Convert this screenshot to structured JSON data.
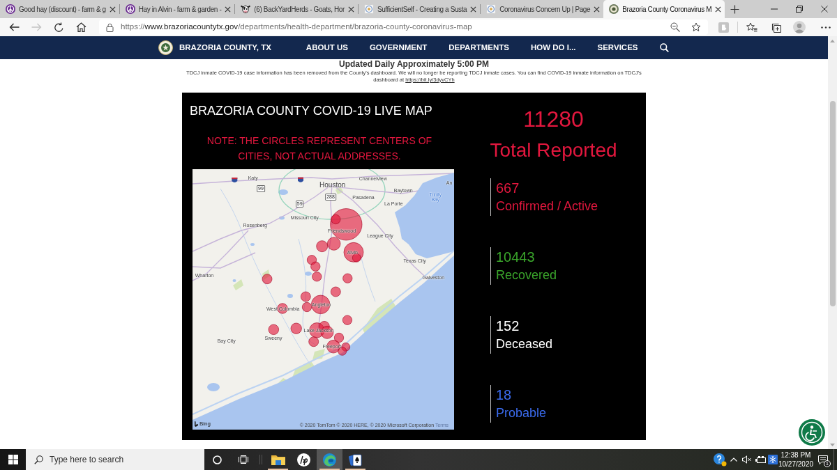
{
  "browser": {
    "tabs": [
      {
        "kind": "peace",
        "title": "Good hay (discount) - farm & g",
        "selected": false
      },
      {
        "kind": "peace",
        "title": "Hay in Alvin - farm & garden -",
        "selected": false
      },
      {
        "kind": "cow",
        "title": "(6) BackYardHerds - Goats, Hor",
        "selected": false
      },
      {
        "kind": "ring",
        "title": "SufficientSelf - Creating a Susta",
        "selected": false
      },
      {
        "kind": "ring",
        "title": "Coronavirus Concern Up | Page",
        "selected": false
      },
      {
        "kind": "seal",
        "title": "Brazoria County Coronavirus M",
        "selected": true
      }
    ],
    "nav_buttons": [
      {
        "kind": "back",
        "disabled": false
      },
      {
        "kind": "forward",
        "disabled": true
      },
      {
        "kind": "refresh",
        "disabled": false
      },
      {
        "kind": "home",
        "disabled": false
      }
    ],
    "address": {
      "scheme": "https://",
      "host": "www.brazoriacountytx.gov",
      "path": "/departments/health-department/brazoria-county-coronavirus-map"
    }
  },
  "site_nav": {
    "title": "BRAZORIA COUNTY, TX",
    "items": [
      "ABOUT US",
      "GOVERNMENT",
      "DEPARTMENTS",
      "HOW DO I...",
      "SERVICES"
    ]
  },
  "page": {
    "updated": "Updated Daily Approximately 5:00 PM",
    "notice": "TDCJ inmate COVID-19 case information has been removed from the County's dashboard. We will no longer be reporting TDCJ inmate cases. You can find COVID-19 inmate information on TDCJ's dashboard at",
    "notice_link": "https://bit.ly/3dyvCYh"
  },
  "dashboard": {
    "title": "BRAZORIA COUNTY COVID-19 LIVE MAP",
    "note": "NOTE: THE CIRCLES REPRESENT CENTERS OF CITIES, NOT ACTUAL ADDRESSES.",
    "map": {
      "labels": [
        {
          "kind": "city",
          "text": "Katy"
        },
        {
          "kind": "major",
          "text": "Houston"
        },
        {
          "kind": "city",
          "text": "Channelview"
        },
        {
          "kind": "city",
          "text": "An"
        },
        {
          "kind": "city",
          "text": "Baytown"
        },
        {
          "kind": "city",
          "text": "Pasadena"
        },
        {
          "kind": "water",
          "text": "Trinity Bay"
        },
        {
          "kind": "city",
          "text": "La Porte"
        },
        {
          "kind": "city",
          "text": "Missouri City"
        },
        {
          "kind": "city",
          "text": "Rosenberg"
        },
        {
          "kind": "city",
          "text": "Friendswood"
        },
        {
          "kind": "city",
          "text": "League City"
        },
        {
          "kind": "city",
          "text": "Alvin"
        },
        {
          "kind": "city",
          "text": "Texas City"
        },
        {
          "kind": "city",
          "text": "Wharton"
        },
        {
          "kind": "city",
          "text": "Galveston"
        },
        {
          "kind": "city",
          "text": "Angleton"
        },
        {
          "kind": "city",
          "text": "West Columbia"
        },
        {
          "kind": "city",
          "text": "Sweeny"
        },
        {
          "kind": "city",
          "text": "Lake Jackson"
        },
        {
          "kind": "city",
          "text": "Bay City"
        },
        {
          "kind": "city",
          "text": "Freeport"
        }
      ],
      "shields": [
        "99",
        "59",
        "288"
      ],
      "logo": "Bing",
      "credit": "© 2020 TomTom © 2020 HERE, © 2020 Microsoft Corporation",
      "terms": "Terms"
    },
    "total": {
      "value": "11280",
      "label": "Total Reported"
    },
    "stats": [
      {
        "value": "667",
        "label": "Confirmed / Active",
        "color": "#e3173e"
      },
      {
        "value": "10443",
        "label": "Recovered",
        "color": "#3aa52b"
      },
      {
        "value": "152",
        "label": "Deceased",
        "color": "#ffffff"
      },
      {
        "value": "18",
        "label": "Probable",
        "color": "#3b6cf0"
      }
    ]
  },
  "taskbar": {
    "search_placeholder": "Type here to search",
    "apps": [
      {
        "kind": "explorer",
        "running": true,
        "selected": false
      },
      {
        "kind": "hp",
        "running": false,
        "selected": false
      },
      {
        "kind": "edge",
        "running": true,
        "selected": true
      },
      {
        "kind": "solitaire",
        "running": true,
        "selected": false
      }
    ],
    "time": "12:38 PM",
    "date": "10/27/2020",
    "notifications": "1"
  }
}
